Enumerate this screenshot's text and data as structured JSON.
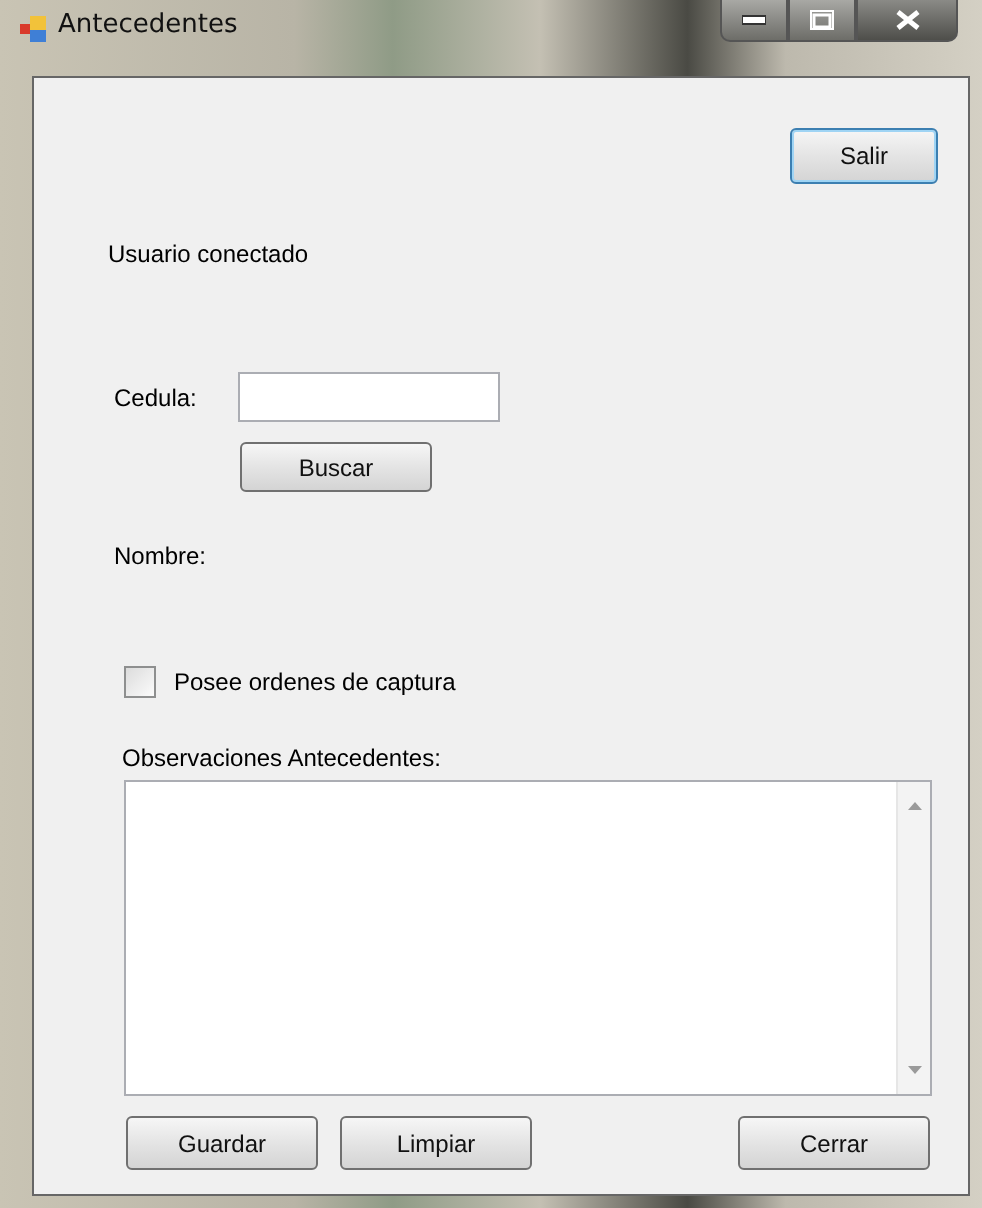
{
  "window": {
    "title": "Antecedentes"
  },
  "exit_button": "Salir",
  "user_label": "Usuario conectado",
  "cedula_label": "Cedula:",
  "search_button": "Buscar",
  "name_label": "Nombre:",
  "warrants": {
    "label": "Posee ordenes de captura",
    "checked": false
  },
  "observations_label": "Observaciones Antecedentes:",
  "buttons": [
    "Guardar",
    "Limpiar",
    "Cerrar"
  ]
}
